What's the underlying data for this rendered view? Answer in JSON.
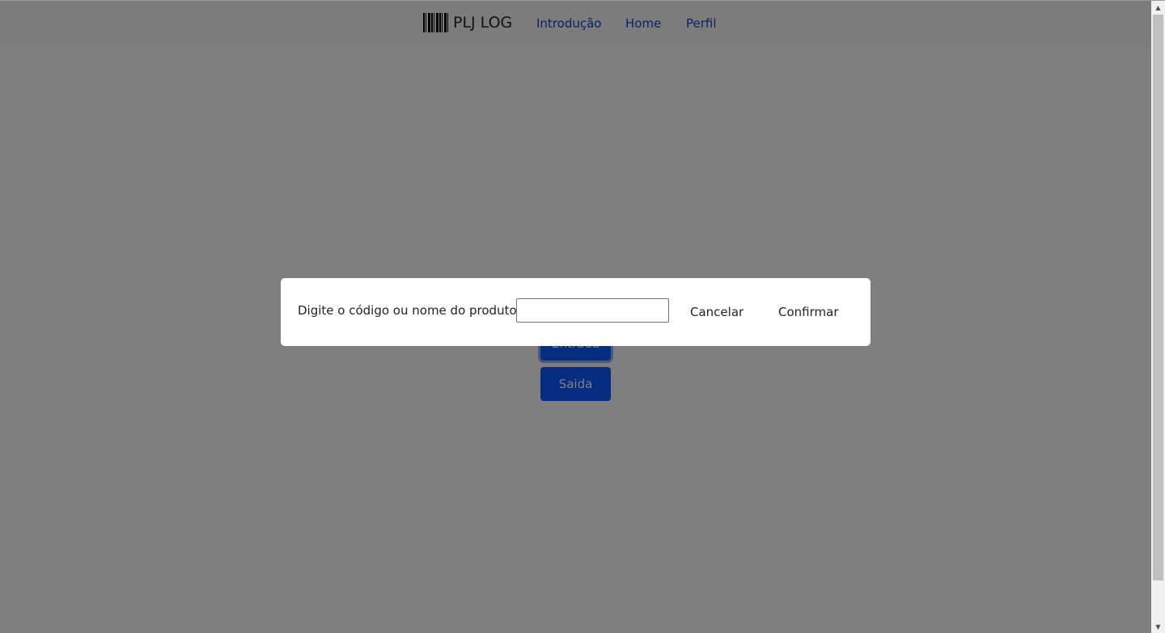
{
  "navbar": {
    "brand": "PLJ LOG",
    "links": [
      "Introdução",
      "Home",
      "Perfil"
    ]
  },
  "main": {
    "entrada_label": "Entrada",
    "saida_label": "Saida"
  },
  "modal": {
    "label": "Digite o código ou nome do produto:",
    "input_value": "",
    "cancel_label": "Cancelar",
    "confirm_label": "Confirmar"
  },
  "icons": {
    "brand_icon": "barcode-icon",
    "scroll_up": "scroll-up-arrow-icon",
    "scroll_down": "scroll-down-arrow-icon"
  },
  "colors": {
    "primary": "#0d5bff",
    "link": "#0d47c8",
    "overlay": "rgba(0,0,0,0.5)"
  }
}
